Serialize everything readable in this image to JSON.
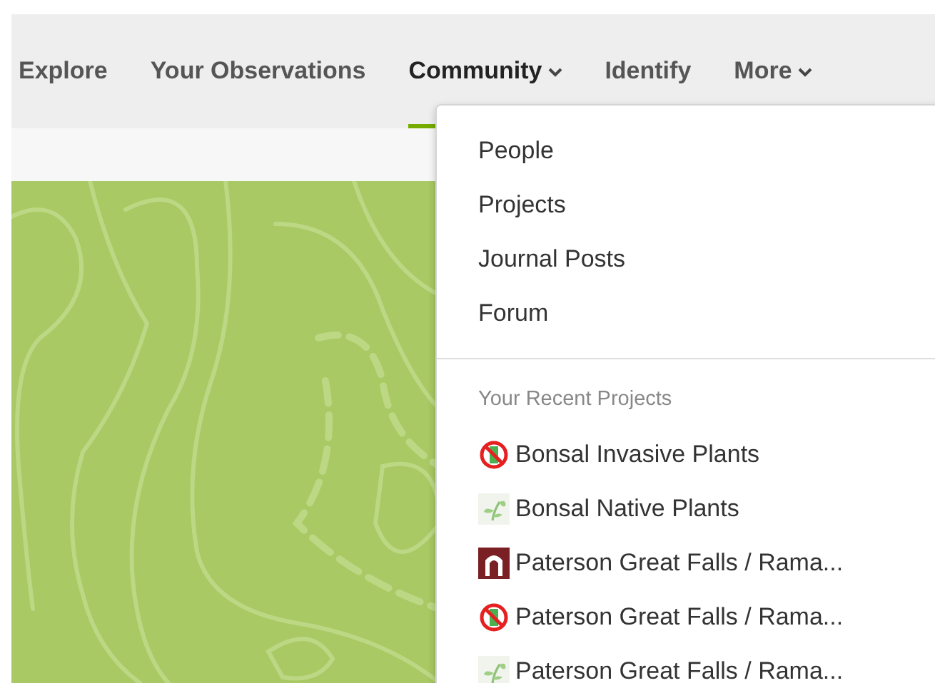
{
  "nav": {
    "items": [
      {
        "label": "Explore",
        "selected": false,
        "caret": false
      },
      {
        "label": "Your Observations",
        "selected": false,
        "caret": false
      },
      {
        "label": "Community",
        "selected": true,
        "caret": true
      },
      {
        "label": "Identify",
        "selected": false,
        "caret": false
      },
      {
        "label": "More",
        "selected": false,
        "caret": true
      }
    ]
  },
  "dropdown": {
    "links": [
      "People",
      "Projects",
      "Journal Posts",
      "Forum"
    ],
    "recent_heading": "Your Recent Projects",
    "recent_projects": [
      {
        "name": "Bonsal Invasive Plants",
        "kind": "invasive"
      },
      {
        "name": "Bonsal Native Plants",
        "kind": "sprout"
      },
      {
        "name": "Paterson Great Falls / Rama...",
        "kind": "arch"
      },
      {
        "name": "Paterson Great Falls / Rama...",
        "kind": "invasive"
      },
      {
        "name": "Paterson Great Falls / Rama...",
        "kind": "sprout"
      }
    ]
  }
}
